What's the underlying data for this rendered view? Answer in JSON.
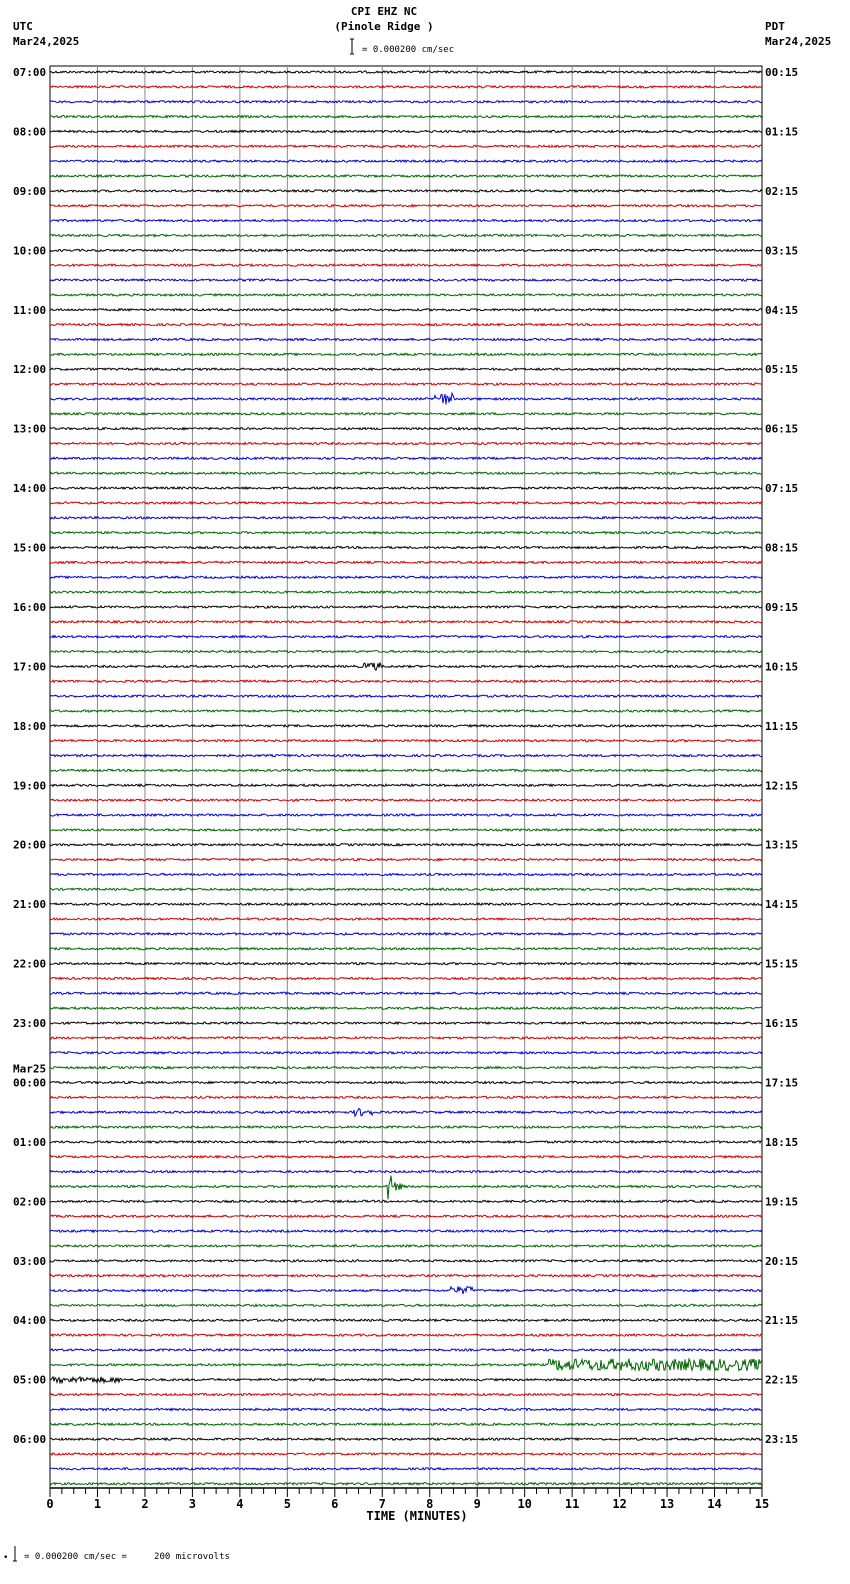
{
  "header": {
    "station": "CPI EHZ NC",
    "location": "(Pinole Ridge )",
    "left_tz": "UTC",
    "left_date": "Mar24,2025",
    "right_tz": "PDT",
    "right_date": "Mar24,2025",
    "scale_text": "= 0.000200 cm/sec"
  },
  "footer": {
    "scale_text": "= 0.000200 cm/sec =     200 microvolts"
  },
  "colors": {
    "trace_cycle": [
      "#000000",
      "#cc0000",
      "#0000cc",
      "#006600"
    ],
    "grid": "#888888"
  },
  "chart_data": {
    "type": "line",
    "title": "CPI EHZ NC (Pinole Ridge )",
    "xlabel": "TIME (MINUTES)",
    "xlim": [
      0,
      15
    ],
    "x_ticks": [
      "0",
      "1",
      "2",
      "3",
      "4",
      "5",
      "6",
      "7",
      "8",
      "9",
      "10",
      "11",
      "12",
      "13",
      "14",
      "15"
    ],
    "traces_per_hour": 4,
    "trace_count": 96,
    "left_labels": [
      {
        "trace": 0,
        "text": "07:00"
      },
      {
        "trace": 4,
        "text": "08:00"
      },
      {
        "trace": 8,
        "text": "09:00"
      },
      {
        "trace": 12,
        "text": "10:00"
      },
      {
        "trace": 16,
        "text": "11:00"
      },
      {
        "trace": 20,
        "text": "12:00"
      },
      {
        "trace": 24,
        "text": "13:00"
      },
      {
        "trace": 28,
        "text": "14:00"
      },
      {
        "trace": 32,
        "text": "15:00"
      },
      {
        "trace": 36,
        "text": "16:00"
      },
      {
        "trace": 40,
        "text": "17:00"
      },
      {
        "trace": 44,
        "text": "18:00"
      },
      {
        "trace": 48,
        "text": "19:00"
      },
      {
        "trace": 52,
        "text": "20:00"
      },
      {
        "trace": 56,
        "text": "21:00"
      },
      {
        "trace": 60,
        "text": "22:00"
      },
      {
        "trace": 64,
        "text": "23:00"
      },
      {
        "trace": 68,
        "text": "00:00",
        "date": "Mar25"
      },
      {
        "trace": 72,
        "text": "01:00"
      },
      {
        "trace": 76,
        "text": "02:00"
      },
      {
        "trace": 80,
        "text": "03:00"
      },
      {
        "trace": 84,
        "text": "04:00"
      },
      {
        "trace": 88,
        "text": "05:00"
      },
      {
        "trace": 92,
        "text": "06:00"
      }
    ],
    "right_labels": [
      "00:15",
      "01:15",
      "02:15",
      "03:15",
      "04:15",
      "05:15",
      "06:15",
      "07:15",
      "08:15",
      "09:15",
      "10:15",
      "11:15",
      "12:15",
      "13:15",
      "14:15",
      "15:15",
      "16:15",
      "17:15",
      "18:15",
      "19:15",
      "20:15",
      "21:15",
      "22:15",
      "23:15"
    ],
    "events": [
      {
        "trace": 22,
        "start_min": 8.1,
        "end_min": 8.5,
        "amplitude": 6
      },
      {
        "trace": 40,
        "start_min": 6.6,
        "end_min": 7.0,
        "amplitude": 4
      },
      {
        "trace": 70,
        "start_min": 6.4,
        "end_min": 6.8,
        "amplitude": 4
      },
      {
        "trace": 75,
        "start_min": 7.1,
        "end_min": 7.7,
        "amplitude": 20
      },
      {
        "trace": 82,
        "start_min": 8.4,
        "end_min": 8.9,
        "amplitude": 4
      },
      {
        "trace": 87,
        "start_min": 10.5,
        "end_min": 15,
        "amplitude": 6
      },
      {
        "trace": 88,
        "start_min": 0,
        "end_min": 1.5,
        "amplitude": 3
      }
    ]
  }
}
